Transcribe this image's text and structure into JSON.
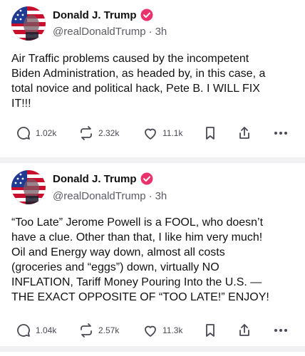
{
  "posts": [
    {
      "author_name": "Donald J. Trump",
      "handle": "@realDonaldTrump",
      "separator": "·",
      "time": "3h",
      "text": "Air Traffic problems caused by the incompetent\nBiden Administration, as headed by, in this case, a\ntotal novice and political hack, Pete B. I WILL FIX\nIT!!!",
      "replies": "1.02k",
      "reposts": "2.32k",
      "likes": "11.1k"
    },
    {
      "author_name": "Donald J. Trump",
      "handle": "@realDonaldTrump",
      "separator": "·",
      "time": "3h",
      "text": "“Too Late” Jerome Powell is a FOOL, who doesn’t\nhave a clue. Other than that, I like him very much!\nOil and Energy way down, almost all costs\n(groceries and “eggs”) down, virtually NO\nINFLATION, Tariff Money Pouring Into the U.S. —\nTHE EXACT OPPOSITE OF “TOO LATE!” ENJOY!",
      "replies": "1.04k",
      "reposts": "2.57k",
      "likes": "11.3k"
    }
  ],
  "icons": {
    "reply": "reply-icon",
    "repost": "repost-icon",
    "like": "heart-icon",
    "bookmark": "bookmark-icon",
    "share": "share-icon",
    "more": "more-icon",
    "verified": "verified-badge-icon"
  },
  "colors": {
    "verified": "#e8336d",
    "text": "#111111",
    "muted": "#5b5b66",
    "divider": "#f1f1f4"
  }
}
